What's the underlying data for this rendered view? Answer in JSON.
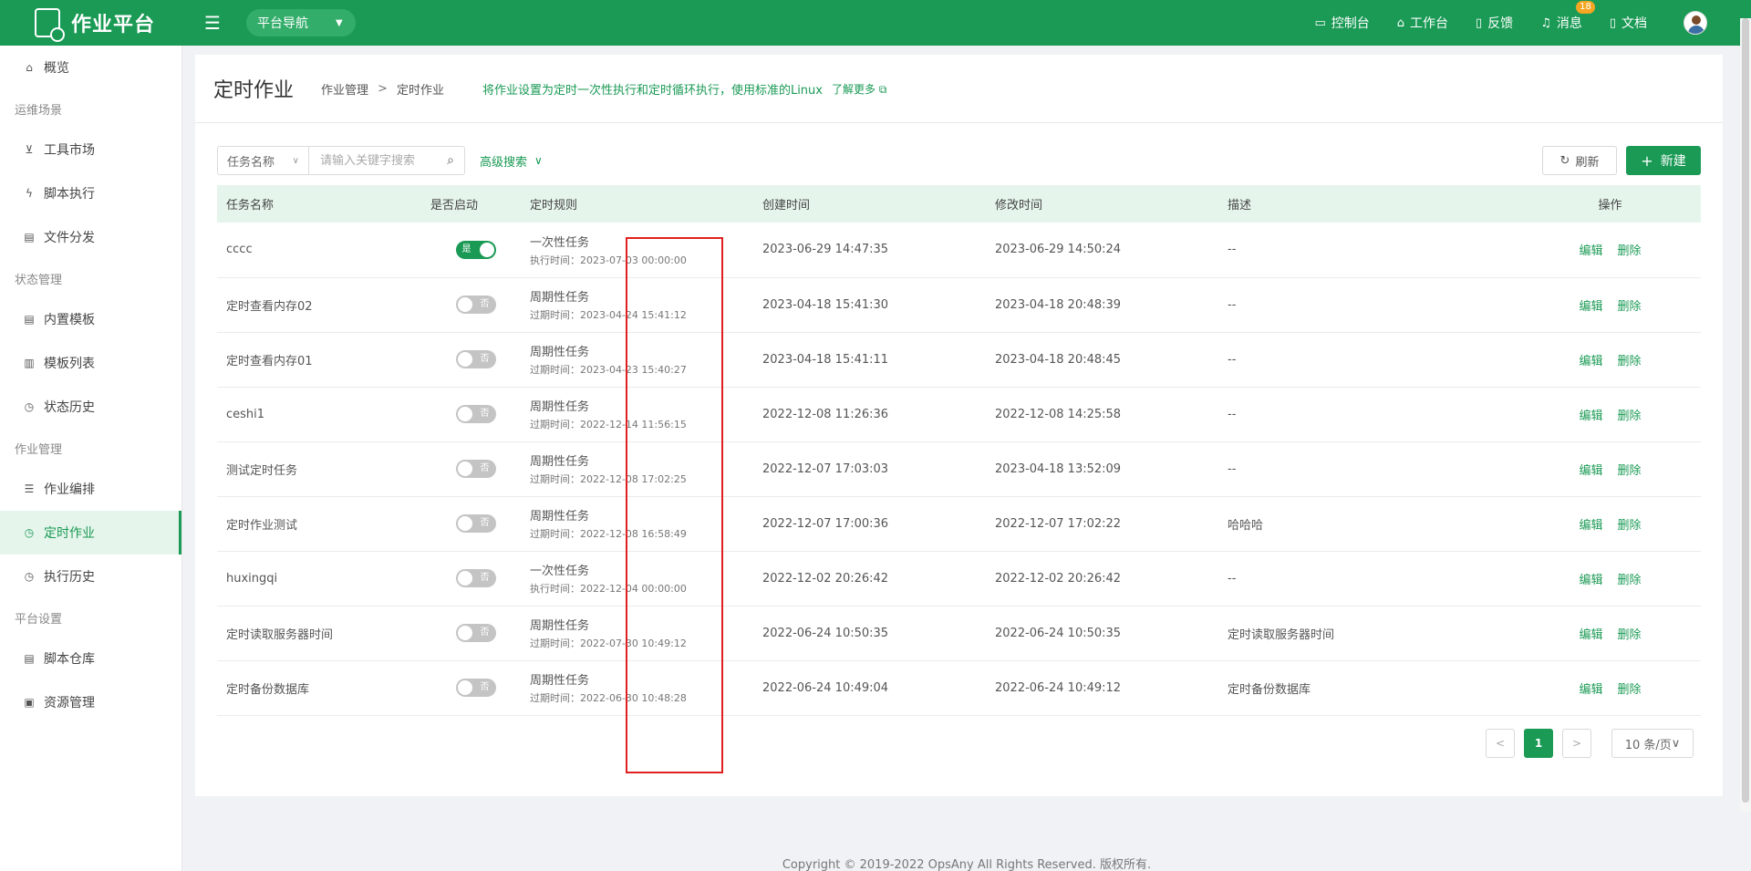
{
  "app": {
    "title": "作业平台"
  },
  "topnav": {
    "platform_nav": "平台导航",
    "items": [
      {
        "label": "控制台",
        "icon": "monitor-icon"
      },
      {
        "label": "工作台",
        "icon": "home-icon"
      },
      {
        "label": "反馈",
        "icon": "feedback-icon"
      },
      {
        "label": "消息",
        "icon": "bell-icon",
        "badge": "18"
      },
      {
        "label": "文档",
        "icon": "doc-icon"
      }
    ]
  },
  "sidebar": {
    "overview": "概览",
    "groups": [
      {
        "title": "运维场景",
        "items": [
          "工具市场",
          "脚本执行",
          "文件分发"
        ]
      },
      {
        "title": "状态管理",
        "items": [
          "内置模板",
          "模板列表",
          "状态历史"
        ]
      },
      {
        "title": "作业管理",
        "items": [
          "作业编排",
          "定时作业",
          "执行历史"
        ]
      },
      {
        "title": "平台设置",
        "items": [
          "脚本仓库",
          "资源管理"
        ]
      }
    ],
    "active": "定时作业"
  },
  "page": {
    "title": "定时作业",
    "breadcrumb": [
      "作业管理",
      "定时作业"
    ],
    "breadcrumb_sep": ">",
    "description": "将作业设置为定时一次性执行和定时循环执行，使用标准的Linux",
    "learn_more": "了解更多"
  },
  "toolbar": {
    "search_field": "任务名称",
    "search_placeholder": "请输入关键字搜索",
    "advanced_search": "高级搜索",
    "refresh": "刷新",
    "new": "新建"
  },
  "table": {
    "columns": [
      "任务名称",
      "是否启动",
      "定时规则",
      "创建时间",
      "修改时间",
      "描述",
      "操作"
    ],
    "edit_label": "编辑",
    "delete_label": "删除",
    "switch_on_label": "是",
    "switch_off_label": "否",
    "rows": [
      {
        "name": "cccc",
        "enabled": true,
        "rule_type": "一次性任务",
        "rule_time": "执行时间：2023-07-03 00:00:00",
        "created": "2023-06-29 14:47:35",
        "modified": "2023-06-29 14:50:24",
        "desc": "--"
      },
      {
        "name": "定时查看内存02",
        "enabled": false,
        "rule_type": "周期性任务",
        "rule_time": "过期时间：2023-04-24 15:41:12",
        "created": "2023-04-18 15:41:30",
        "modified": "2023-04-18 20:48:39",
        "desc": "--"
      },
      {
        "name": "定时查看内存01",
        "enabled": false,
        "rule_type": "周期性任务",
        "rule_time": "过期时间：2023-04-23 15:40:27",
        "created": "2023-04-18 15:41:11",
        "modified": "2023-04-18 20:48:45",
        "desc": "--"
      },
      {
        "name": "ceshi1",
        "enabled": false,
        "rule_type": "周期性任务",
        "rule_time": "过期时间：2022-12-14 11:56:15",
        "created": "2022-12-08 11:26:36",
        "modified": "2022-12-08 14:25:58",
        "desc": "--"
      },
      {
        "name": "测试定时任务",
        "enabled": false,
        "rule_type": "周期性任务",
        "rule_time": "过期时间：2022-12-08 17:02:25",
        "created": "2022-12-07 17:03:03",
        "modified": "2023-04-18 13:52:09",
        "desc": "--"
      },
      {
        "name": "定时作业测试",
        "enabled": false,
        "rule_type": "周期性任务",
        "rule_time": "过期时间：2022-12-08 16:58:49",
        "created": "2022-12-07 17:00:36",
        "modified": "2022-12-07 17:02:22",
        "desc": "哈哈哈"
      },
      {
        "name": "huxingqi",
        "enabled": false,
        "rule_type": "一次性任务",
        "rule_time": "执行时间：2022-12-04 00:00:00",
        "created": "2022-12-02 20:26:42",
        "modified": "2022-12-02 20:26:42",
        "desc": "--"
      },
      {
        "name": "定时读取服务器时间",
        "enabled": false,
        "rule_type": "周期性任务",
        "rule_time": "过期时间：2022-07-30 10:49:12",
        "created": "2022-06-24 10:50:35",
        "modified": "2022-06-24 10:50:35",
        "desc": "定时读取服务器时间"
      },
      {
        "name": "定时备份数据库",
        "enabled": false,
        "rule_type": "周期性任务",
        "rule_time": "过期时间：2022-06-30 10:48:28",
        "created": "2022-06-24 10:49:04",
        "modified": "2022-06-24 10:49:12",
        "desc": "定时备份数据库"
      }
    ]
  },
  "pagination": {
    "current": "1",
    "prev": "<",
    "next": ">",
    "page_size": "10 条/页"
  },
  "footer": "Copyright © 2019-2022 OpsAny All Rights Reserved. 版权所有.",
  "colors": {
    "primary": "#1a9a55",
    "highlight": "#e02020",
    "badge": "#f5a623"
  }
}
